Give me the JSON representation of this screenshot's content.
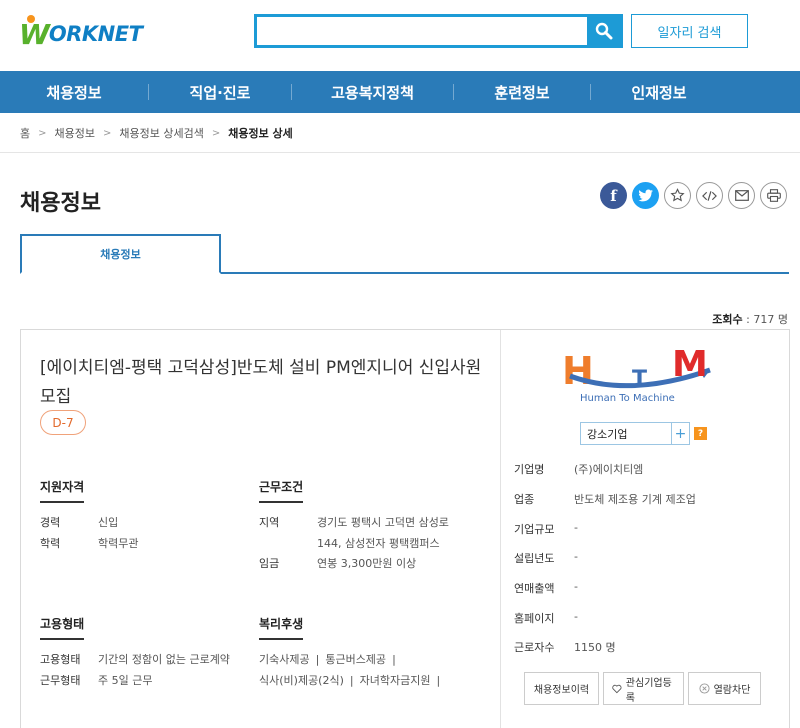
{
  "header": {
    "logo_text": "WORKNET",
    "search": {
      "value": "",
      "placeholder": ""
    },
    "job_search_label": "일자리 검색"
  },
  "gnb": [
    "채용정보",
    "직업·진로",
    "고용복지정책",
    "훈련정보",
    "인재정보"
  ],
  "breadcrumb": [
    "홈",
    "채용정보",
    "채용정보 상세검색",
    "채용정보 상세"
  ],
  "page_title": "채용정보",
  "tab_label": "채용정보",
  "view_count": {
    "label": "조회수",
    "value": ": 717 명"
  },
  "job": {
    "title": "[에이치티엠-평택 고덕삼성]반도체 설비 PM엔지니어 신입사원 모집",
    "dday": "D-7",
    "qualification": {
      "title": "지원자격",
      "rows": [
        {
          "k": "경력",
          "v": "신입"
        },
        {
          "k": "학력",
          "v": "학력무관"
        }
      ]
    },
    "conditions": {
      "title": "근무조건",
      "region_label": "지역",
      "region_line1": "경기도 평택시 고덕면 삼성로",
      "region_line2": "144, 삼성전자 평택캠퍼스",
      "wage_label": "임금",
      "wage": "연봉 3,300만원 이상"
    },
    "employment": {
      "title": "고용형태",
      "rows": [
        {
          "k": "고용형태",
          "v": "기간의 정함이 없는 근로계약"
        },
        {
          "k": "근무형태",
          "v": "주 5일 근무"
        }
      ]
    },
    "welfare": {
      "title": "복리후생",
      "line1": [
        "기숙사제공",
        "통근버스제공"
      ],
      "line2": [
        "식사(비)제공(2식)",
        "자녀학자금지원"
      ]
    }
  },
  "company": {
    "logo_text": "Human To Machine",
    "badge": "강소기업",
    "badge_plus": "+",
    "help": "?",
    "info": [
      {
        "k": "기업명",
        "v": "(주)에이치티엠"
      },
      {
        "k": "업종",
        "v": "반도체 제조용 기계 제조업"
      },
      {
        "k": "기업규모",
        "v": "-"
      },
      {
        "k": "설립년도",
        "v": "-"
      },
      {
        "k": "연매출액",
        "v": "-"
      },
      {
        "k": "홈페이지",
        "v": "-"
      },
      {
        "k": "근로자수",
        "v": "1150 명"
      }
    ],
    "buttons": {
      "history": "채용정보이력",
      "interest": "관심기업등록",
      "block": "열람차단"
    }
  },
  "colors": {
    "primary": "#2a7bb8",
    "accent": "#1d9bd6",
    "dday": "#e2692b",
    "logo_green": "#58b12c",
    "logo_orange": "#f7941d"
  }
}
